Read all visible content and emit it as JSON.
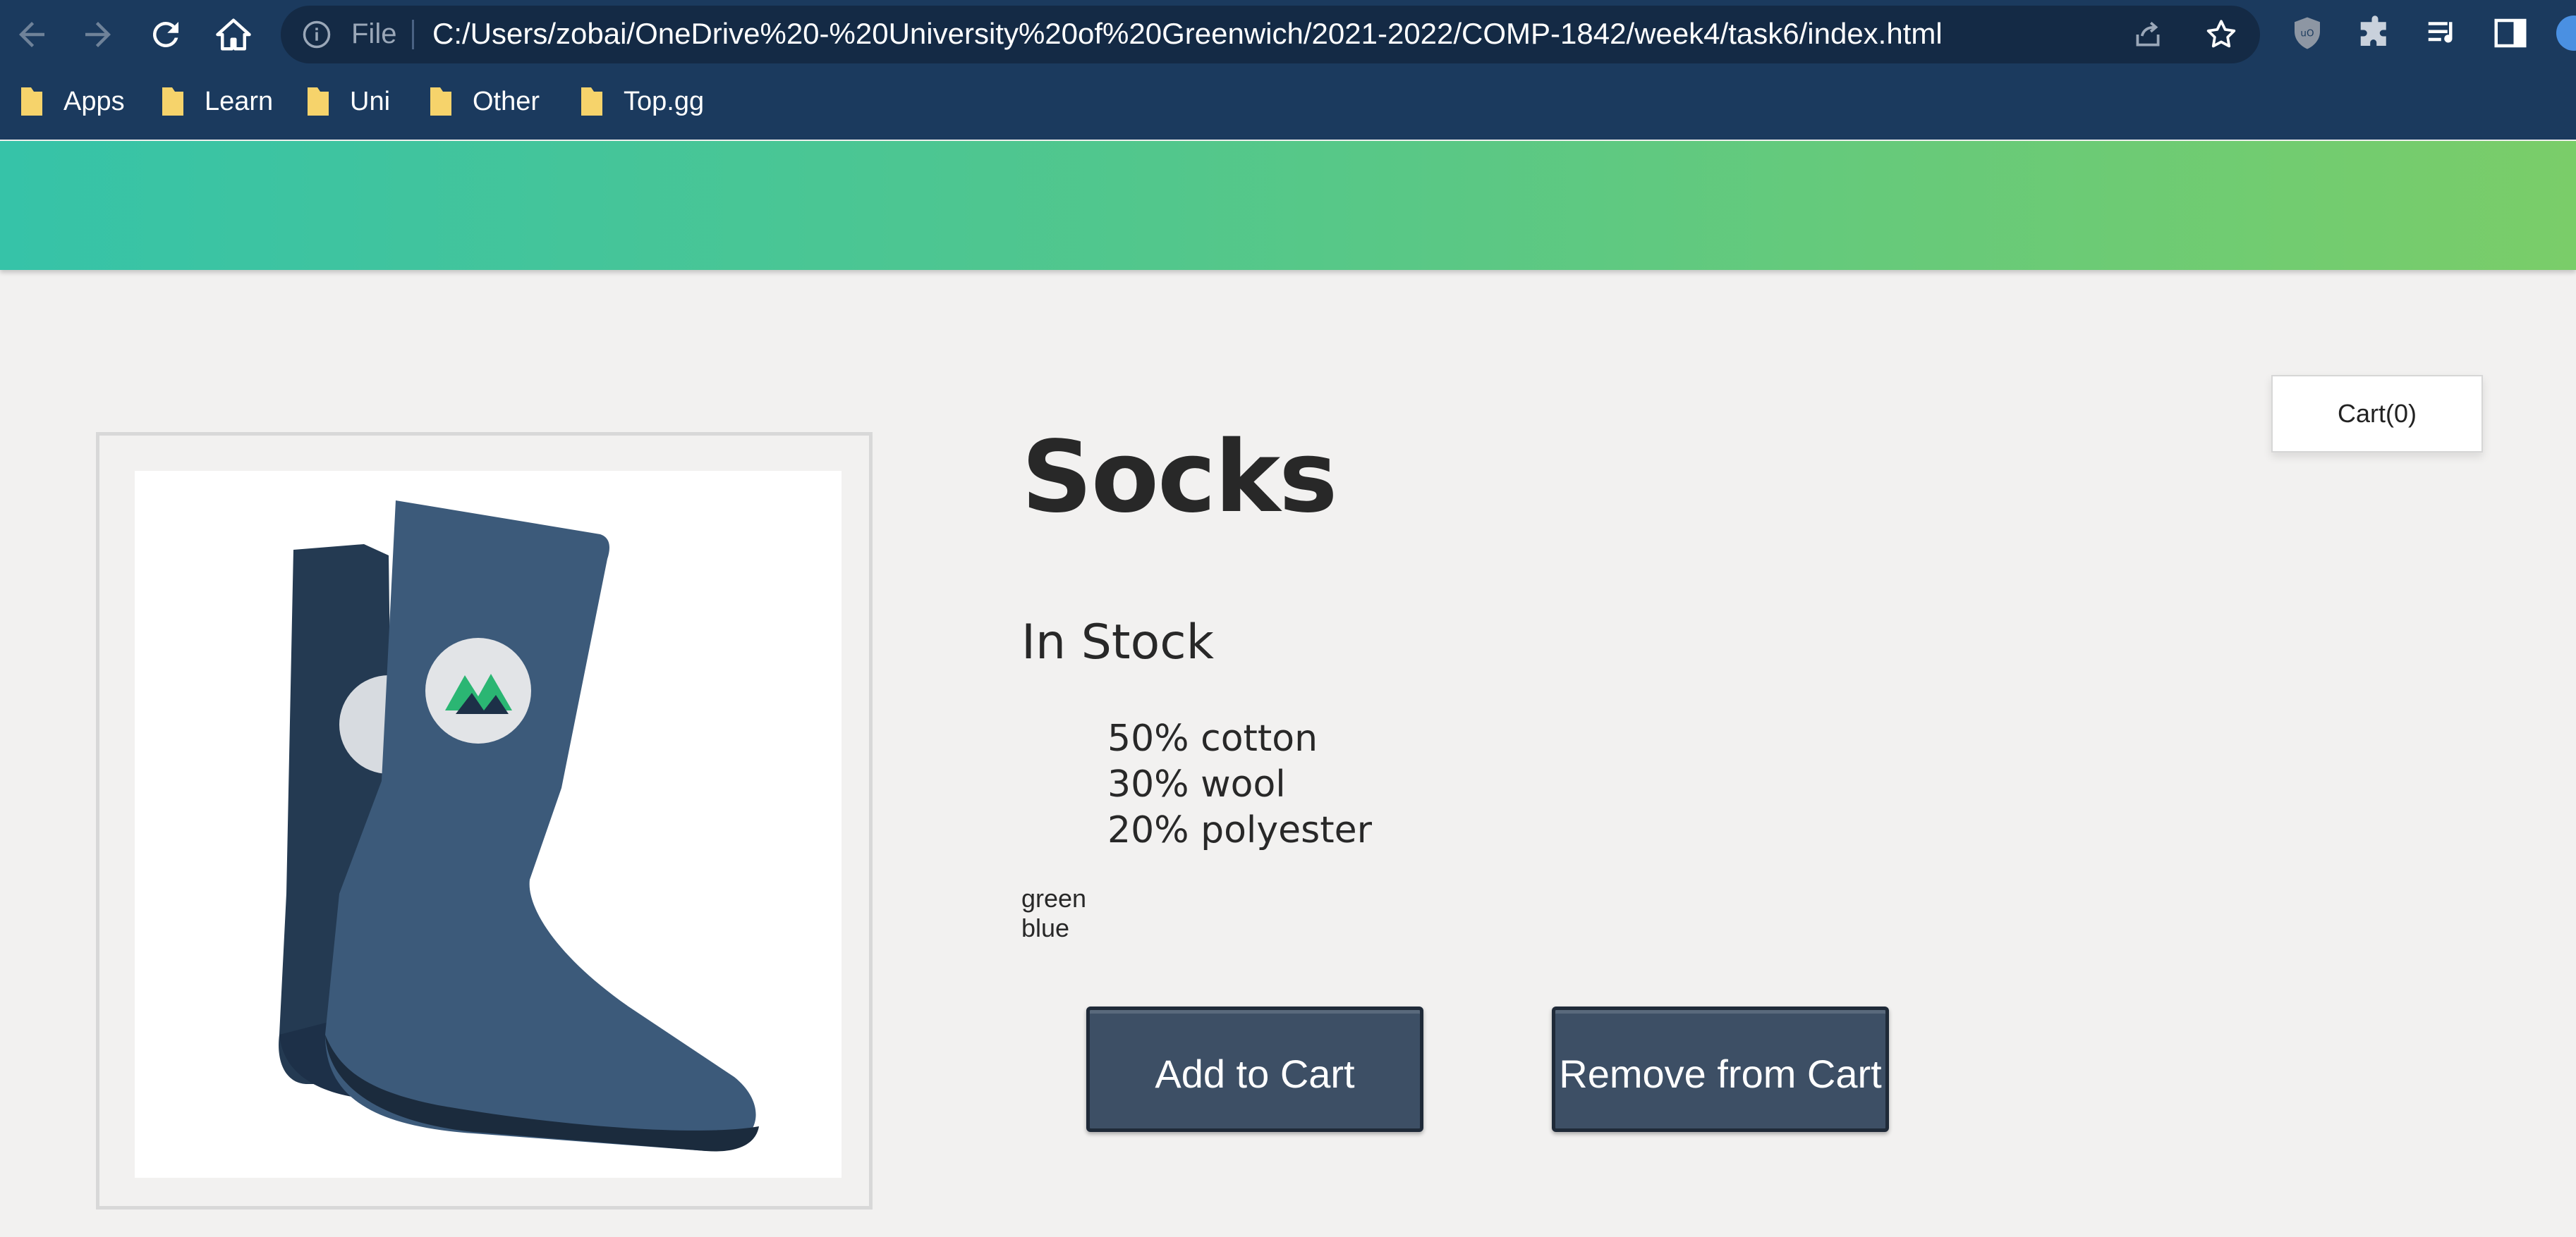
{
  "browser": {
    "address_bar": {
      "scheme_label": "File",
      "url": "C:/Users/zobai/OneDrive%20-%20University%20of%20Greenwich/2021-2022/COMP-1842/week4/task6/index.html"
    },
    "nav_icons": [
      "back-icon",
      "forward-icon",
      "reload-icon",
      "home-icon"
    ],
    "omnibox_icons": [
      "share-icon",
      "star-icon"
    ],
    "extension_icons": [
      "ublock-icon",
      "puzzle-icon",
      "media-queue-icon",
      "side-panel-icon",
      "profile-avatar"
    ],
    "bookmarks": [
      {
        "label": "Apps"
      },
      {
        "label": "Learn"
      },
      {
        "label": "Uni"
      },
      {
        "label": "Other"
      },
      {
        "label": "Top.gg"
      }
    ],
    "chrome_color": "#1b3a5e"
  },
  "page": {
    "banner_colors": [
      "#36c3a8",
      "#7acd69"
    ],
    "cart_label": "Cart(0)",
    "product": {
      "title": "Socks",
      "stock_status": "In Stock",
      "details": [
        "50% cotton",
        "30% wool",
        "20% polyester"
      ],
      "variants": [
        "green",
        "blue"
      ],
      "image_icon": "socks-image"
    },
    "buttons": {
      "add_to_cart": "Add to Cart",
      "remove_from_cart": "Remove from Cart",
      "color": "#3d4f65"
    }
  }
}
